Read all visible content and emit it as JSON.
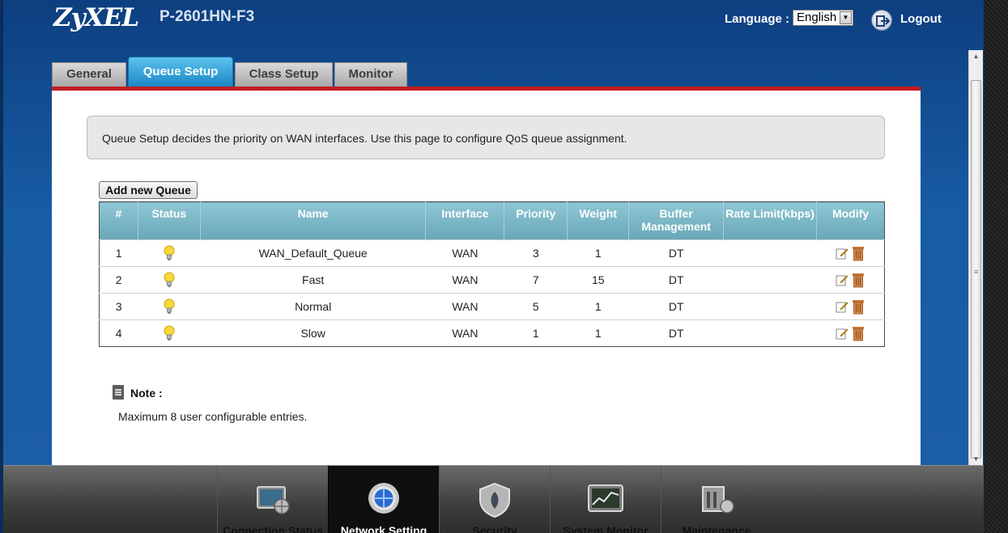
{
  "header": {
    "brand": "ZyXEL",
    "model": "P-2601HN-F3",
    "language_label": "Language :",
    "language_value": "English",
    "logout_label": "Logout"
  },
  "tabs": [
    {
      "label": "General",
      "active": false
    },
    {
      "label": "Queue Setup",
      "active": true
    },
    {
      "label": "Class Setup",
      "active": false
    },
    {
      "label": "Monitor",
      "active": false
    }
  ],
  "description": "Queue Setup decides the priority on WAN interfaces. Use this page to configure QoS queue assignment.",
  "add_button": "Add new Queue",
  "table": {
    "columns": [
      "#",
      "Status",
      "Name",
      "Interface",
      "Priority",
      "Weight",
      "Buffer Management",
      "Rate Limit(kbps)",
      "Modify"
    ],
    "rows": [
      {
        "num": "1",
        "name": "WAN_Default_Queue",
        "interface": "WAN",
        "priority": "3",
        "weight": "1",
        "buffer": "DT",
        "rate": ""
      },
      {
        "num": "2",
        "name": "Fast",
        "interface": "WAN",
        "priority": "7",
        "weight": "15",
        "buffer": "DT",
        "rate": ""
      },
      {
        "num": "3",
        "name": "Normal",
        "interface": "WAN",
        "priority": "5",
        "weight": "1",
        "buffer": "DT",
        "rate": ""
      },
      {
        "num": "4",
        "name": "Slow",
        "interface": "WAN",
        "priority": "1",
        "weight": "1",
        "buffer": "DT",
        "rate": ""
      }
    ]
  },
  "note": {
    "title": "Note :",
    "text": "Maximum 8 user configurable entries."
  },
  "bottom_nav": [
    {
      "label": "Connection Status",
      "icon": "monitor-globe-icon",
      "active": false
    },
    {
      "label": "Network Setting",
      "icon": "network-globe-icon",
      "active": true
    },
    {
      "label": "Security",
      "icon": "shield-icon",
      "active": false
    },
    {
      "label": "System Monitor",
      "icon": "chart-monitor-icon",
      "active": false
    },
    {
      "label": "Maintenance",
      "icon": "tools-icon",
      "active": false
    }
  ],
  "colors": {
    "header_blue": "#185ca4",
    "tab_active": "#1a86c4",
    "tab_redline": "#c51b22",
    "table_header": "#68a7b8"
  }
}
